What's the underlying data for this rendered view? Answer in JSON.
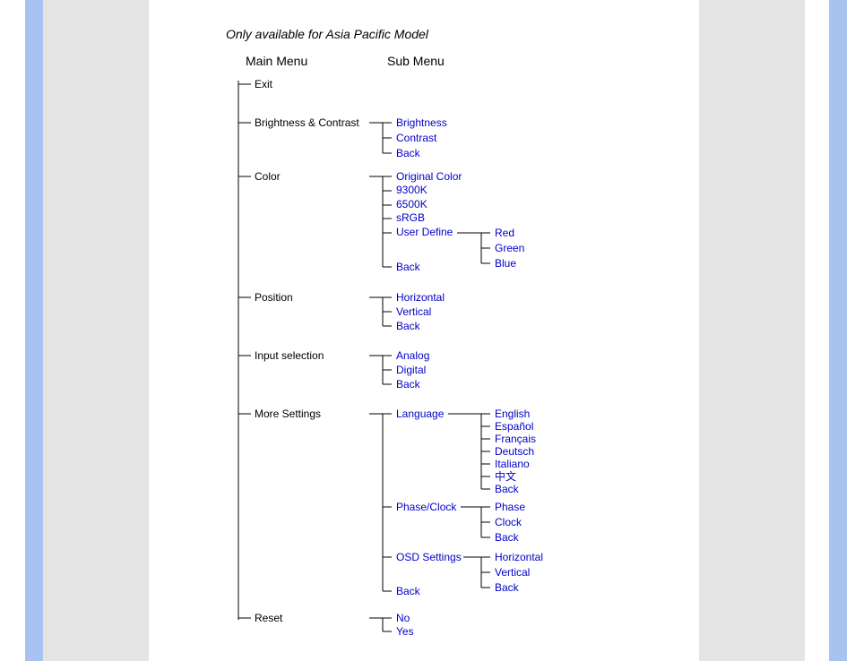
{
  "note": "Only available for Asia Pacific Model",
  "headers": {
    "main": "Main Menu",
    "sub": "Sub Menu"
  },
  "main": {
    "exit": "Exit",
    "brightness_contrast": "Brightness & Contrast",
    "color": "Color",
    "position": "Position",
    "input_selection": "Input selection",
    "more_settings": "More Settings",
    "reset": "Reset"
  },
  "sub": {
    "brightness": "Brightness",
    "contrast": "Contrast",
    "back": "Back",
    "original_color": "Original Color",
    "k9300": "9300K",
    "k6500": "6500K",
    "srgb": "sRGB",
    "user_define": "User Define",
    "red": "Red",
    "green": "Green",
    "blue": "Blue",
    "horizontal": "Horizontal",
    "vertical": "Vertical",
    "analog": "Analog",
    "digital": "Digital",
    "language": "Language",
    "english": "English",
    "espanol": "Español",
    "francais": "Français",
    "deutsch": "Deutsch",
    "italiano": "Italiano",
    "chinese": "中文",
    "phase_clock": "Phase/Clock",
    "phase": "Phase",
    "clock": "Clock",
    "osd_settings": "OSD Settings",
    "no": "No",
    "yes": "Yes"
  }
}
